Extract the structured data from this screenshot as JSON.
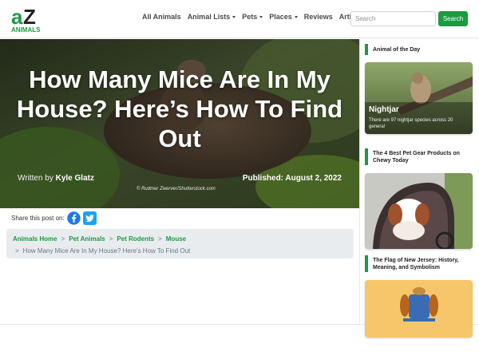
{
  "header": {
    "logo_alt": "AZ Animals",
    "logo_wordmark": "ANIMALS",
    "nav": [
      {
        "label": "All Animals",
        "dropdown": false
      },
      {
        "label": "Animal Lists",
        "dropdown": true
      },
      {
        "label": "Pets",
        "dropdown": true
      },
      {
        "label": "Places",
        "dropdown": true
      },
      {
        "label": "Reviews",
        "dropdown": false
      },
      {
        "label": "Articles",
        "dropdown": false
      }
    ],
    "search_placeholder": "Search",
    "search_button": "Search",
    "accent_color": "#1a9b41"
  },
  "hero": {
    "title": "How Many Mice Are In My House? Here’s How To Find Out",
    "byline_prefix": "Written by",
    "author": "Kyle Glatz",
    "published": "Published: August 2, 2022",
    "credit": "© Rudmer Zwerver/Shutterstock.com"
  },
  "share": {
    "label": "Share this post on:",
    "networks": [
      "facebook-icon",
      "twitter-icon"
    ]
  },
  "breadcrumb": {
    "links": [
      "Animals Home",
      "Pet Animals",
      "Pet Rodents",
      "Mouse"
    ],
    "current": "How Many Mice Are In My House? Here’s How To Find Out",
    "separator": ">"
  },
  "sidebar": {
    "animal_of_day": {
      "heading": "Animal of the Day",
      "name": "Nightjar",
      "description": "There are 97 nightjar species across 20 genera!"
    },
    "pet_gear": {
      "heading": "The 4 Best Pet Gear Products on Chewy Today"
    },
    "nj_flag": {
      "heading": "The Flag of New Jersey: History, Meaning, and Symbolism"
    }
  }
}
